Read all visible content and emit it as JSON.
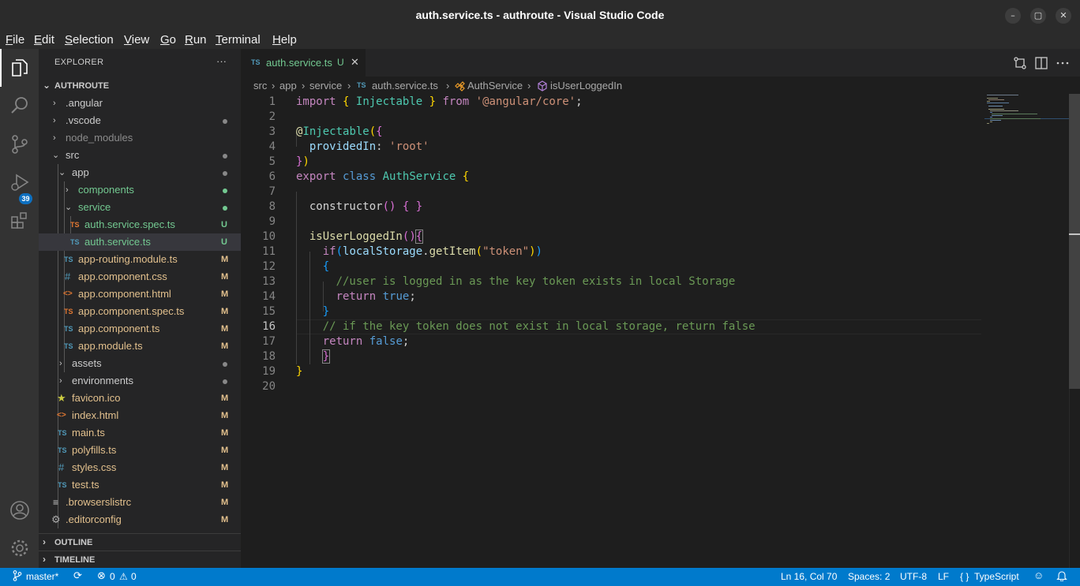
{
  "window": {
    "title": "auth.service.ts - authroute - Visual Studio Code",
    "buttons": {
      "minimize": "–",
      "maximize": "▢",
      "close": "✕"
    }
  },
  "menu": [
    "File",
    "Edit",
    "Selection",
    "View",
    "Go",
    "Run",
    "Terminal",
    "Help"
  ],
  "activity_bar": {
    "icons": [
      "explorer-icon",
      "search-icon",
      "source-control-icon",
      "run-debug-icon",
      "extensions-icon",
      "account-icon",
      "manage-gear-icon"
    ],
    "source_control_badge": "39"
  },
  "explorer": {
    "header": "EXPLORER",
    "more_label": "···",
    "root": "AUTHROUTE",
    "items": [
      {
        "name": ".angular",
        "status": ""
      },
      {
        "name": ".vscode",
        "status": ""
      },
      {
        "name": "node_modules",
        "status": ""
      },
      {
        "name": "src",
        "status": ""
      },
      {
        "name": "app",
        "status": ""
      },
      {
        "name": "components",
        "status": ""
      },
      {
        "name": "service",
        "status": ""
      },
      {
        "name": "auth.service.spec.ts",
        "status": "U",
        "icon": "TS"
      },
      {
        "name": "auth.service.ts",
        "status": "U",
        "icon": "TS"
      },
      {
        "name": "app-routing.module.ts",
        "status": "M",
        "icon": "TS"
      },
      {
        "name": "app.component.css",
        "status": "M",
        "icon": "#"
      },
      {
        "name": "app.component.html",
        "status": "M",
        "icon": "<>"
      },
      {
        "name": "app.component.spec.ts",
        "status": "M",
        "icon": "TS"
      },
      {
        "name": "app.component.ts",
        "status": "M",
        "icon": "TS"
      },
      {
        "name": "app.module.ts",
        "status": "M",
        "icon": "TS"
      },
      {
        "name": "assets",
        "status": ""
      },
      {
        "name": "environments",
        "status": ""
      },
      {
        "name": "favicon.ico",
        "status": "M",
        "icon": "★"
      },
      {
        "name": "index.html",
        "status": "M",
        "icon": "<>"
      },
      {
        "name": "main.ts",
        "status": "M",
        "icon": "TS"
      },
      {
        "name": "polyfills.ts",
        "status": "M",
        "icon": "TS"
      },
      {
        "name": "styles.css",
        "status": "M",
        "icon": "#"
      },
      {
        "name": "test.ts",
        "status": "M",
        "icon": "TS"
      },
      {
        "name": ".browserslistrc",
        "status": "M",
        "icon": "≡"
      },
      {
        "name": ".editorconfig",
        "status": "M",
        "icon": "⚙"
      }
    ],
    "outline": "OUTLINE",
    "timeline": "TIMELINE"
  },
  "tab": {
    "icon": "TS",
    "label": "auth.service.ts",
    "status": "U",
    "close": "✕"
  },
  "breadcrumb": [
    "src",
    "app",
    "service",
    "auth.service.ts",
    "AuthService",
    "isUserLoggedIn"
  ],
  "breadcrumb_sep": "›",
  "breadcrumb_ts": "TS",
  "editor": {
    "line_numbers": [
      "1",
      "2",
      "3",
      "4",
      "5",
      "6",
      "7",
      "8",
      "9",
      "10",
      "11",
      "12",
      "13",
      "14",
      "15",
      "16",
      "17",
      "18",
      "19",
      "20"
    ],
    "current_line": "16",
    "lines": [
      "import { Injectable } from '@angular/core';",
      "",
      "@Injectable({",
      "  providedIn: 'root'",
      "})",
      "export class AuthService {",
      "",
      "  constructor() { }",
      "",
      "  isUserLoggedIn(){",
      "    if(localStorage.getItem(\"token\"))",
      "    {",
      "      //user is logged in as the key token exists in local Storage",
      "      return true;",
      "    }",
      "    // if the key token does not exist in local storage, return false",
      "    return false;",
      "    }",
      "}",
      ""
    ]
  },
  "status_bar": {
    "branch": "master*",
    "sync_icon": "⟳",
    "errors": "0",
    "warnings": "0",
    "error_icon": "⊗",
    "warning_icon": "⚠",
    "position": "Ln 16, Col 70",
    "spaces": "Spaces: 2",
    "encoding": "UTF-8",
    "eol": "LF",
    "language_braces": "{ }",
    "language": "TypeScript",
    "feedback_icon": "☺",
    "bell_icon": "🔔"
  },
  "colors": {
    "accent": "#007acc",
    "untracked": "#73c991",
    "modified": "#e2c08d",
    "ts_icon": "#519aba"
  }
}
